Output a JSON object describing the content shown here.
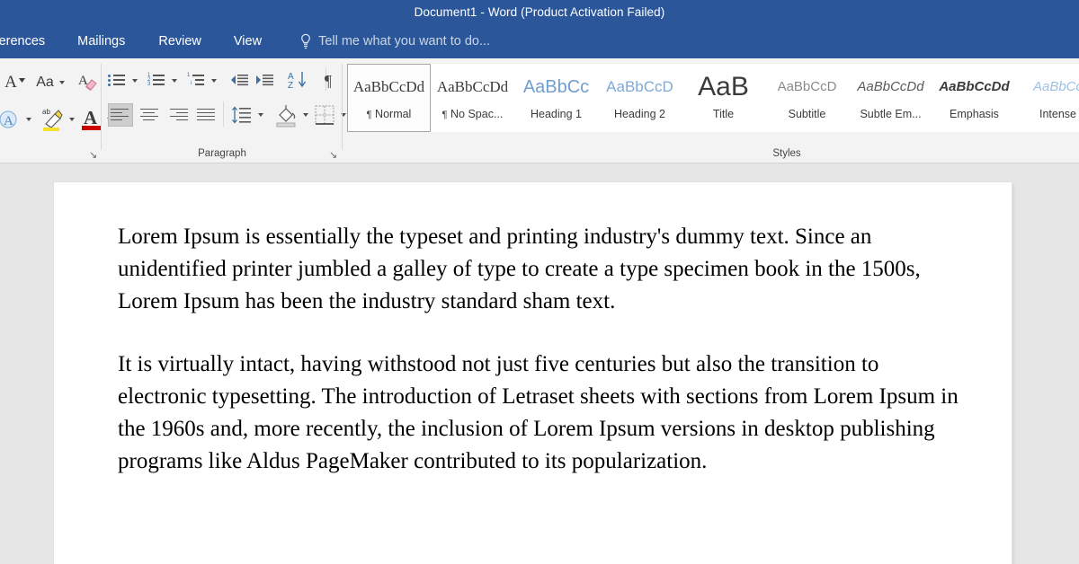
{
  "window": {
    "title": "Document1 - Word (Product Activation Failed)"
  },
  "ribbon_tabs": [
    {
      "label": "References",
      "active": false
    },
    {
      "label": "Mailings",
      "active": false
    },
    {
      "label": "Review",
      "active": false
    },
    {
      "label": "View",
      "active": false
    }
  ],
  "tell_me": {
    "placeholder": "Tell me what you want to do...",
    "icon": "lightbulb-icon"
  },
  "groups": {
    "font": {
      "label": "",
      "dialog_launcher": "↘",
      "buttons": [
        {
          "name": "decrease-font-size-button",
          "glyph": "A"
        },
        {
          "name": "change-case-button",
          "glyph": "Aa"
        },
        {
          "name": "clear-formatting-button",
          "glyph": "A"
        },
        {
          "name": "text-effects-button",
          "glyph": "A"
        },
        {
          "name": "text-highlight-color-button",
          "glyph": "ab"
        },
        {
          "name": "font-color-button",
          "glyph": "A"
        }
      ]
    },
    "paragraph": {
      "label": "Paragraph",
      "dialog_launcher": "↘",
      "buttons": [
        {
          "name": "bullets-button",
          "tooltip": "Bullets"
        },
        {
          "name": "numbering-button",
          "tooltip": "Numbering"
        },
        {
          "name": "multilevel-list-button",
          "tooltip": "Multilevel List"
        },
        {
          "name": "decrease-indent-button",
          "tooltip": "Decrease Indent"
        },
        {
          "name": "increase-indent-button",
          "tooltip": "Increase Indent"
        },
        {
          "name": "sort-button",
          "tooltip": "Sort",
          "glyph": "A\nZ"
        },
        {
          "name": "show-formatting-marks-button",
          "glyph": "¶"
        },
        {
          "name": "align-left-button",
          "active": true
        },
        {
          "name": "align-center-button",
          "active": false
        },
        {
          "name": "align-right-button",
          "active": false
        },
        {
          "name": "justify-button",
          "active": false
        },
        {
          "name": "line-spacing-button"
        },
        {
          "name": "shading-button"
        },
        {
          "name": "borders-button"
        }
      ]
    },
    "styles": {
      "label": "Styles",
      "items": [
        {
          "preview": "AaBbCcDd",
          "name": "Normal",
          "pilcrow": true,
          "selected": true,
          "class": ""
        },
        {
          "preview": "AaBbCcDd",
          "name": "No Spac...",
          "pilcrow": true,
          "selected": false,
          "class": ""
        },
        {
          "preview": "AaBbCc",
          "name": "Heading 1",
          "pilcrow": false,
          "selected": false,
          "class": "sp-h1"
        },
        {
          "preview": "AaBbCcD",
          "name": "Heading 2",
          "pilcrow": false,
          "selected": false,
          "class": "sp-h2"
        },
        {
          "preview": "AaB",
          "name": "Title",
          "pilcrow": false,
          "selected": false,
          "class": "sp-title"
        },
        {
          "preview": "AaBbCcD",
          "name": "Subtitle",
          "pilcrow": false,
          "selected": false,
          "class": "sp-sub"
        },
        {
          "preview": "AaBbCcDd",
          "name": "Subtle Em...",
          "pilcrow": false,
          "selected": false,
          "class": "sp-subtle"
        },
        {
          "preview": "AaBbCcDd",
          "name": "Emphasis",
          "pilcrow": false,
          "selected": false,
          "class": "sp-emph"
        },
        {
          "preview": "AaBbCc",
          "name": "Intense",
          "pilcrow": false,
          "selected": false,
          "class": "sp-intense"
        }
      ]
    }
  },
  "document": {
    "paragraphs": [
      "Lorem Ipsum is essentially the typeset and printing industry's dummy text. Since an unidentified printer jumbled a galley of type to create a type specimen book in the 1500s, Lorem Ipsum has been the industry standard sham text.",
      "It is virtually intact, having withstood not just five centuries but also the transition to electronic typesetting. The introduction of Letraset sheets with sections from Lorem Ipsum in the 1960s and, more recently, the inclusion of Lorem Ipsum versions in desktop publishing programs like Aldus PageMaker contributed to its popularization."
    ]
  },
  "colors": {
    "titlebar": "#2b579a",
    "ribbon": "#f3f3f3",
    "canvas": "#e6e6e6",
    "page": "#ffffff",
    "accent_blue": "#3a6ea5"
  }
}
